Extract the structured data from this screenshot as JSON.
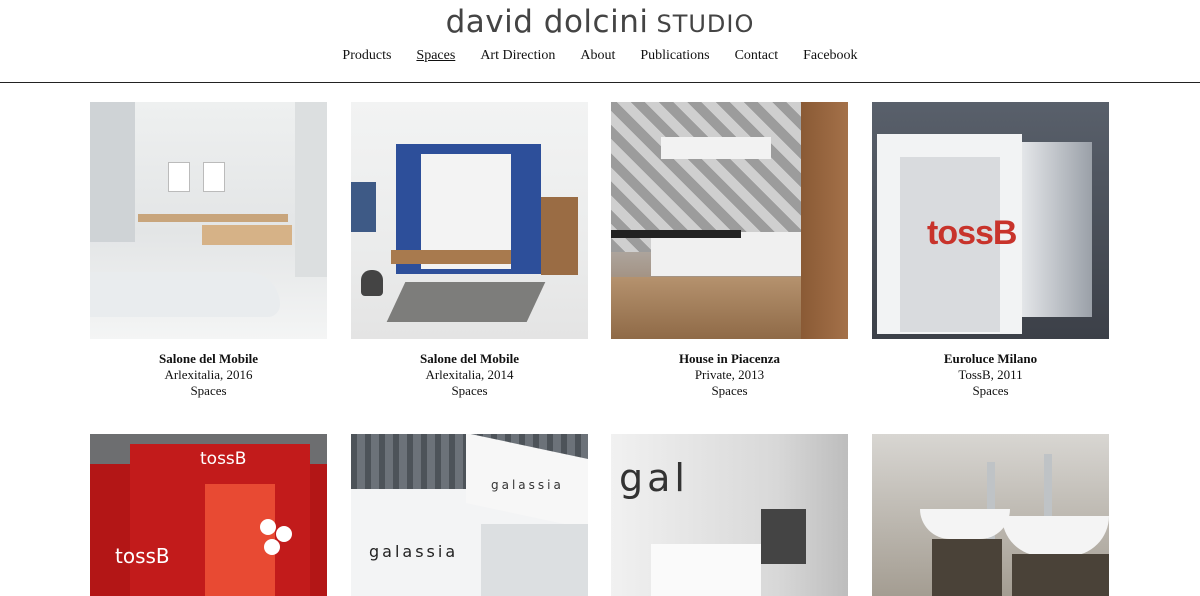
{
  "brand": {
    "name": "david dolcini",
    "suffix": "STUDIO"
  },
  "nav": [
    "Products",
    "Spaces",
    "Art Direction",
    "About",
    "Publications",
    "Contact",
    "Facebook"
  ],
  "active_nav": "Spaces",
  "projects": [
    {
      "title": "Salone del Mobile",
      "client": "Arlexitalia, 2016",
      "category": "Spaces"
    },
    {
      "title": "Salone del Mobile",
      "client": "Arlexitalia, 2014",
      "category": "Spaces"
    },
    {
      "title": "House in Piacenza",
      "client": "Private, 2013",
      "category": "Spaces"
    },
    {
      "title": "Euroluce Milano",
      "client": "TossB, 2011",
      "category": "Spaces"
    }
  ],
  "thumb_texts": {
    "tossb_sign": "tossB",
    "tossb_red_top": "tossB",
    "tossb_red_side": "tossB",
    "galassia_top": "galassia",
    "galassia_front": "galassia",
    "gal_sign": "gal"
  }
}
